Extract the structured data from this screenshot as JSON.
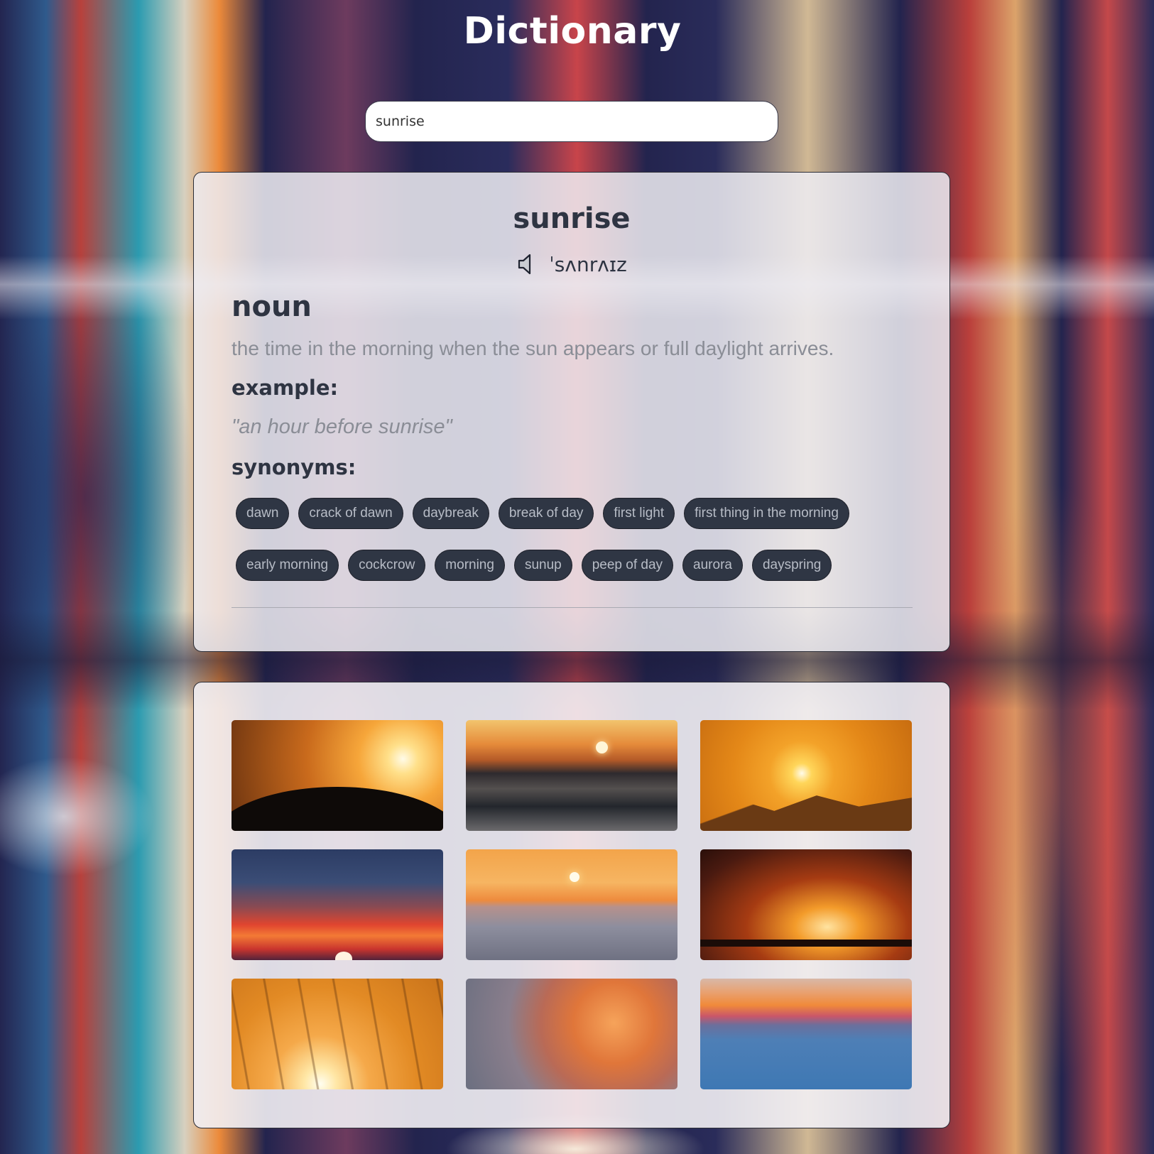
{
  "app": {
    "title": "Dictionary"
  },
  "search": {
    "value": "sunrise"
  },
  "entry": {
    "word": "sunrise",
    "phonetic": "ˈsʌnrʌɪz",
    "audio_icon": "speaker-icon",
    "part_of_speech": "noun",
    "definition": "the time in the morning when the sun appears or full daylight arrives.",
    "example_label": "example:",
    "example": "\"an hour before sunrise\"",
    "synonyms_label": "synonyms:",
    "synonyms_row1": [
      "dawn",
      "crack of dawn",
      "daybreak",
      "break of day",
      "first light",
      "first thing in the morning"
    ],
    "synonyms_row2": [
      "early morning",
      "cockcrow",
      "morning",
      "sunup",
      "peep of day",
      "aurora",
      "dayspring"
    ]
  },
  "gallery": {
    "count": 9
  }
}
